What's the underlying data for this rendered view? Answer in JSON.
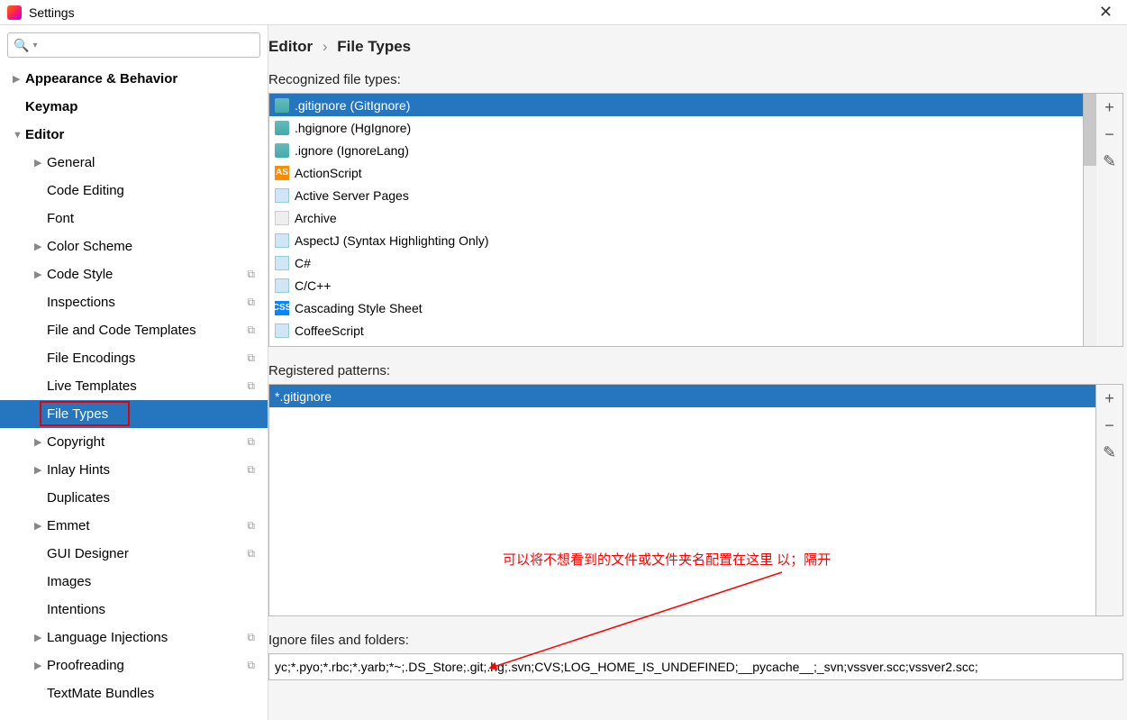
{
  "window": {
    "title": "Settings"
  },
  "search": {
    "placeholder": ""
  },
  "tree": {
    "items": [
      {
        "label": "Appearance & Behavior",
        "level": 1,
        "bold": true,
        "arrow": "▶",
        "copy": false,
        "selected": false
      },
      {
        "label": "Keymap",
        "level": 1,
        "bold": true,
        "arrow": "",
        "copy": false,
        "selected": false
      },
      {
        "label": "Editor",
        "level": 1,
        "bold": true,
        "arrow": "▼",
        "copy": false,
        "selected": false
      },
      {
        "label": "General",
        "level": 2,
        "bold": false,
        "arrow": "▶",
        "copy": false,
        "selected": false
      },
      {
        "label": "Code Editing",
        "level": 2,
        "bold": false,
        "arrow": "",
        "copy": false,
        "selected": false
      },
      {
        "label": "Font",
        "level": 2,
        "bold": false,
        "arrow": "",
        "copy": false,
        "selected": false
      },
      {
        "label": "Color Scheme",
        "level": 2,
        "bold": false,
        "arrow": "▶",
        "copy": false,
        "selected": false
      },
      {
        "label": "Code Style",
        "level": 2,
        "bold": false,
        "arrow": "▶",
        "copy": true,
        "selected": false
      },
      {
        "label": "Inspections",
        "level": 2,
        "bold": false,
        "arrow": "",
        "copy": true,
        "selected": false
      },
      {
        "label": "File and Code Templates",
        "level": 2,
        "bold": false,
        "arrow": "",
        "copy": true,
        "selected": false
      },
      {
        "label": "File Encodings",
        "level": 2,
        "bold": false,
        "arrow": "",
        "copy": true,
        "selected": false
      },
      {
        "label": "Live Templates",
        "level": 2,
        "bold": false,
        "arrow": "",
        "copy": true,
        "selected": false
      },
      {
        "label": "File Types",
        "level": 2,
        "bold": false,
        "arrow": "",
        "copy": false,
        "selected": true
      },
      {
        "label": "Copyright",
        "level": 2,
        "bold": false,
        "arrow": "▶",
        "copy": true,
        "selected": false
      },
      {
        "label": "Inlay Hints",
        "level": 2,
        "bold": false,
        "arrow": "▶",
        "copy": true,
        "selected": false
      },
      {
        "label": "Duplicates",
        "level": 2,
        "bold": false,
        "arrow": "",
        "copy": false,
        "selected": false
      },
      {
        "label": "Emmet",
        "level": 2,
        "bold": false,
        "arrow": "▶",
        "copy": true,
        "selected": false
      },
      {
        "label": "GUI Designer",
        "level": 2,
        "bold": false,
        "arrow": "",
        "copy": true,
        "selected": false
      },
      {
        "label": "Images",
        "level": 2,
        "bold": false,
        "arrow": "",
        "copy": false,
        "selected": false
      },
      {
        "label": "Intentions",
        "level": 2,
        "bold": false,
        "arrow": "",
        "copy": false,
        "selected": false
      },
      {
        "label": "Language Injections",
        "level": 2,
        "bold": false,
        "arrow": "▶",
        "copy": true,
        "selected": false
      },
      {
        "label": "Proofreading",
        "level": 2,
        "bold": false,
        "arrow": "▶",
        "copy": true,
        "selected": false
      },
      {
        "label": "TextMate Bundles",
        "level": 2,
        "bold": false,
        "arrow": "",
        "copy": false,
        "selected": false
      }
    ]
  },
  "breadcrumb": {
    "part1": "Editor",
    "part2": "File Types"
  },
  "labels": {
    "recognized": "Recognized file types:",
    "patterns": "Registered patterns:",
    "ignore": "Ignore files and folders:"
  },
  "filetypes": [
    {
      "label": ".gitignore (GitIgnore)",
      "icon": "ic-ignore",
      "selected": true
    },
    {
      "label": ".hgignore (HgIgnore)",
      "icon": "ic-ignore",
      "selected": false
    },
    {
      "label": ".ignore (IgnoreLang)",
      "icon": "ic-ignore",
      "selected": false
    },
    {
      "label": "ActionScript",
      "icon": "ic-as",
      "selected": false
    },
    {
      "label": "Active Server Pages",
      "icon": "ic-doc",
      "selected": false
    },
    {
      "label": "Archive",
      "icon": "ic-archive",
      "selected": false
    },
    {
      "label": "AspectJ (Syntax Highlighting Only)",
      "icon": "ic-doc",
      "selected": false
    },
    {
      "label": "C#",
      "icon": "ic-doc",
      "selected": false
    },
    {
      "label": "C/C++",
      "icon": "ic-doc",
      "selected": false
    },
    {
      "label": "Cascading Style Sheet",
      "icon": "ic-css",
      "selected": false
    },
    {
      "label": "CoffeeScript",
      "icon": "ic-doc",
      "selected": false
    }
  ],
  "patterns": [
    {
      "label": "*.gitignore",
      "selected": true
    }
  ],
  "ignore_value": "yc;*.pyo;*.rbc;*.yarb;*~;.DS_Store;.git;.hg;.svn;CVS;LOG_HOME_IS_UNDEFINED;__pycache__;_svn;vssver.scc;vssver2.scc;",
  "annotation": "可以将不想看到的文件或文件夹名配置在这里 以；隔开"
}
